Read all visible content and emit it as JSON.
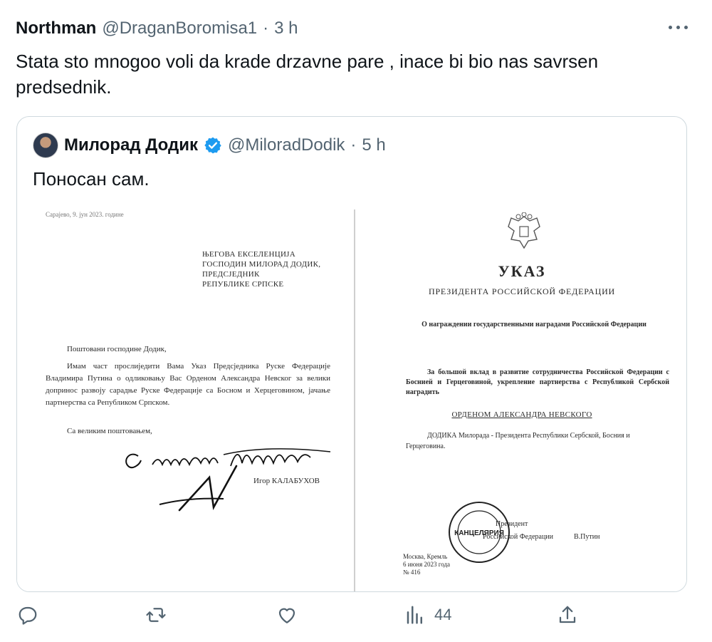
{
  "tweet": {
    "author_name": "Northman",
    "author_handle": "@DraganBoromisa1",
    "separator": "·",
    "time": "3 h",
    "text": "Stata sto mnogoo voli da krade drzavne pare , inace bi bio nas savrsen predsednik.",
    "more_icon": "more-dots-icon"
  },
  "quoted": {
    "author_name": "Милорад Додик",
    "author_handle": "@MiloradDodik",
    "separator": "·",
    "time": "5 h",
    "text": "Поносан сам.",
    "verified_color": "#1d9bf0"
  },
  "document_left": {
    "date": "Сарајево, 9. јун 2023. године",
    "address": "ЊЕГОВА ЕКСЕЛЕНЦИЈА\nГОСПОДИН МИЛОРАД ДОДИК,\nПРЕДСЈЕДНИК\nРЕПУБЛИКЕ СРПСКЕ",
    "greeting": "Поштовани господине Додик,",
    "body": "Имам част прослиједити Вама Указ Предсједника Руске Федерације Владимира Путина о одликовању Вас Орденом Александра Невског за велики допринос развоју сарадње Руске Федерације са Босном и Херцеговином, јачање партнерства са Републиком Српском.",
    "closing": "Са великим поштовањем,",
    "signer": "Игор КАЛАБУХОВ"
  },
  "document_right": {
    "title": "УКАЗ",
    "subtitle": "ПРЕЗИДЕНТА РОССИЙСКОЙ ФЕДЕРАЦИИ",
    "about": "О награждении государственными наградами Российской Федерации",
    "paragraph": "За большой вклад в развитие сотрудничества Российской Федерации с Боснией и Герцеговиной, укрепление партнерства с Республикой Сербской наградить",
    "order": "ОРДЕНОМ АЛЕКСАНДРА НЕВСКОГО",
    "recipient": "ДОДИКА Милорада - Президента Республики Сербской, Босния и Герцеговина.",
    "stamp_text": "КАНЦЕЛЯРИЯ",
    "president_line1": "Президент",
    "president_line2": "Российской Федерации",
    "president_name": "В.Путин",
    "place": "Москва, Кремль",
    "date": "6 июня 2023 года",
    "number": "№ 416"
  },
  "actions": {
    "reply_icon": "reply-icon",
    "retweet_icon": "retweet-icon",
    "like_icon": "like-icon",
    "views_icon": "views-icon",
    "views_count": "44",
    "share_icon": "share-icon"
  }
}
